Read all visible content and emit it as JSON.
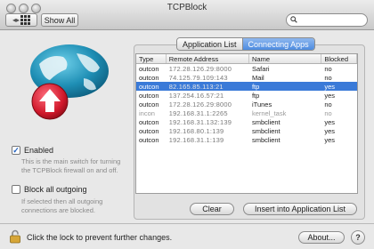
{
  "window": {
    "title": "TCPBlock"
  },
  "toolbar": {
    "show_all_label": "Show All",
    "search_placeholder": ""
  },
  "enabled": {
    "label": "Enabled",
    "checked": true,
    "description": "This is the main switch for turning the TCPBlock firewall on and off."
  },
  "block_all": {
    "label": "Block all outgoing",
    "checked": false,
    "description": "If selected then all outgoing connections are blocked."
  },
  "tabs": [
    {
      "label": "Application List",
      "active": false
    },
    {
      "label": "Connecting Apps",
      "active": true
    }
  ],
  "table": {
    "headers": [
      "Type",
      "Remote Address",
      "Name",
      "Blocked"
    ],
    "rows": [
      {
        "type": "outcon",
        "address": "172.28.126.29:8000",
        "name": "Safari",
        "blocked": "no",
        "selected": false,
        "dim": false
      },
      {
        "type": "outcon",
        "address": "74.125.79.109:143",
        "name": "Mail",
        "blocked": "no",
        "selected": false,
        "dim": false
      },
      {
        "type": "outcon",
        "address": "82.165.85.113:21",
        "name": "ftp",
        "blocked": "yes",
        "selected": true,
        "dim": false
      },
      {
        "type": "outcon",
        "address": "137.254.16.57:21",
        "name": "ftp",
        "blocked": "yes",
        "selected": false,
        "dim": false
      },
      {
        "type": "outcon",
        "address": "172.28.126.29:8000",
        "name": "iTunes",
        "blocked": "no",
        "selected": false,
        "dim": false
      },
      {
        "type": "incon",
        "address": "192.168.31.1:2265",
        "name": "kernel_task",
        "blocked": "no",
        "selected": false,
        "dim": true
      },
      {
        "type": "outcon",
        "address": "192.168.31.132:139",
        "name": "smbclient",
        "blocked": "yes",
        "selected": false,
        "dim": false
      },
      {
        "type": "outcon",
        "address": "192.168.80.1:139",
        "name": "smbclient",
        "blocked": "yes",
        "selected": false,
        "dim": false
      },
      {
        "type": "outcon",
        "address": "192.168.31.1:139",
        "name": "smbclient",
        "blocked": "yes",
        "selected": false,
        "dim": false
      }
    ]
  },
  "buttons": {
    "clear": "Clear",
    "insert": "Insert into Application List",
    "about": "About..."
  },
  "footer": {
    "lock_text": "Click the lock to prevent further changes."
  },
  "colors": {
    "selection": "#3a7ad8",
    "globe": "#1f7f9f",
    "arrow_badge": "#d0182b"
  },
  "icons": {
    "globe": "globe-icon",
    "lock": "lock-icon",
    "search": "search-icon",
    "help": "help-icon"
  }
}
